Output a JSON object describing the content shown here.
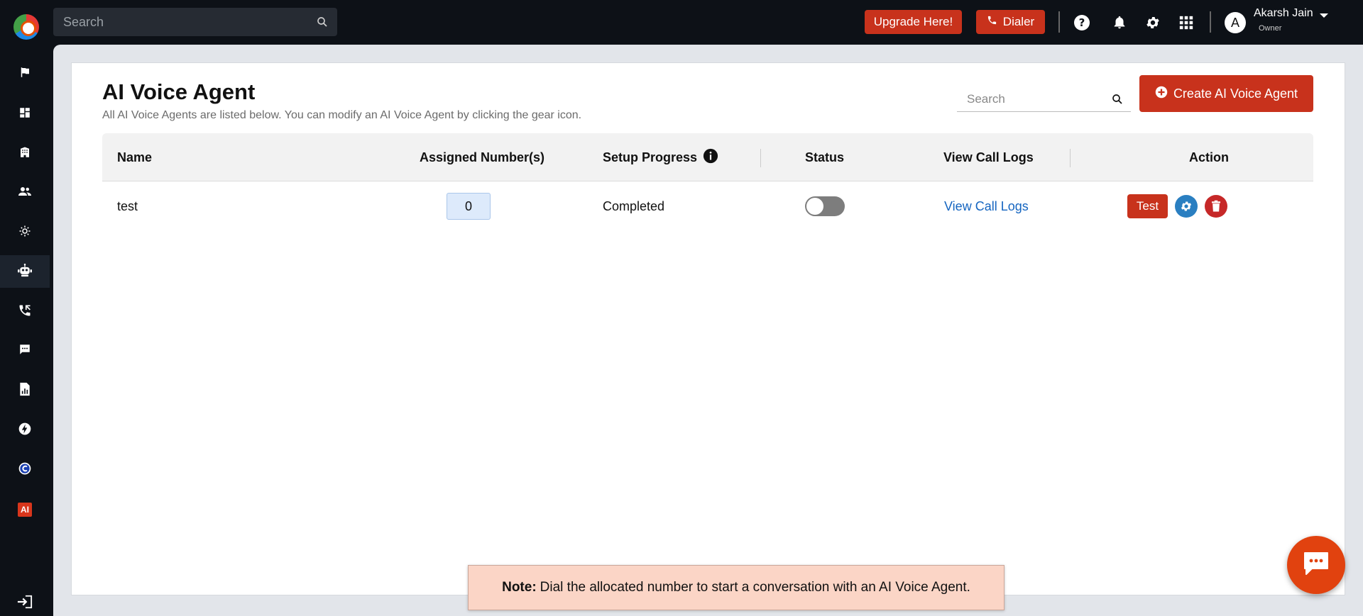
{
  "topbar": {
    "search_placeholder": "Search",
    "upgrade_label": "Upgrade Here!",
    "dialer_label": "Dialer",
    "user": {
      "initial": "A",
      "name": "Akarsh Jain",
      "role": "Owner"
    }
  },
  "sidebar": {
    "items": [
      {
        "icon": "flag-icon"
      },
      {
        "icon": "dashboard-icon"
      },
      {
        "icon": "building-icon"
      },
      {
        "icon": "users-icon"
      },
      {
        "icon": "integrations-icon"
      },
      {
        "icon": "robot-icon",
        "active": true
      },
      {
        "icon": "call-transfer-icon"
      },
      {
        "icon": "chat-icon"
      },
      {
        "icon": "report-icon"
      },
      {
        "icon": "bolt-icon"
      },
      {
        "icon": "c-logo-icon"
      },
      {
        "icon": "ai-icon",
        "label": "AI"
      },
      {
        "icon": "logout-icon"
      }
    ]
  },
  "page": {
    "title": "AI Voice Agent",
    "subtitle": "All AI Voice Agents are listed below. You can modify an AI Voice Agent by clicking the gear icon.",
    "search_placeholder": "Search",
    "create_label": "Create AI Voice Agent"
  },
  "table": {
    "headers": {
      "name": "Name",
      "numbers": "Assigned Number(s)",
      "progress": "Setup Progress",
      "status": "Status",
      "logs": "View Call Logs",
      "action": "Action"
    },
    "rows": [
      {
        "name": "test",
        "numbers": "0",
        "progress": "Completed",
        "status_on": false,
        "logs": "View Call Logs",
        "test_label": "Test"
      }
    ]
  },
  "note": {
    "label": "Note:",
    "text": "Dial the allocated number to start a conversation with an AI Voice Agent."
  },
  "colors": {
    "accent": "#c8321c",
    "link": "#1565c0",
    "gear": "#2a7fc1",
    "delete": "#c62828",
    "fab": "#e1420f"
  }
}
